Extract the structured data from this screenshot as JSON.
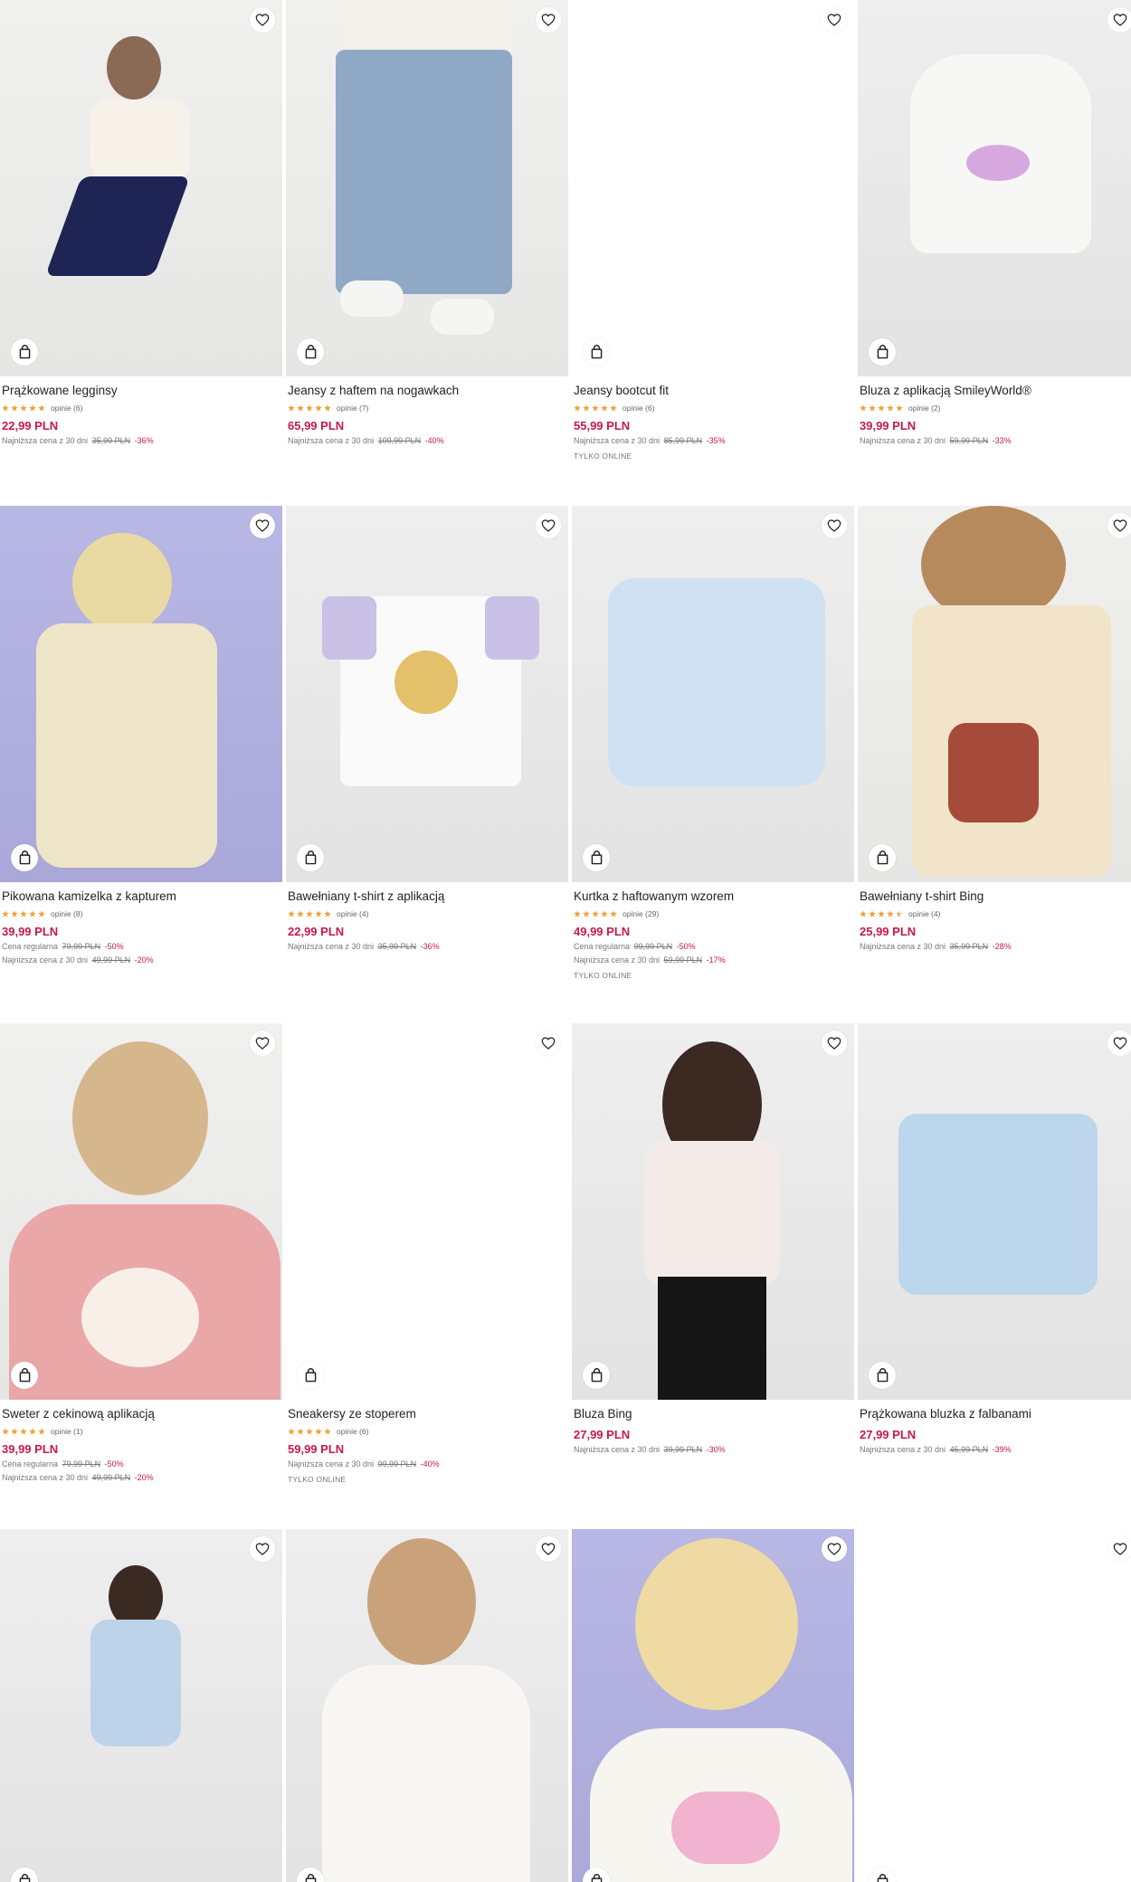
{
  "products": [
    {
      "name": "Prążkowane legginsy",
      "rating": 5,
      "reviews": "opinie (6)",
      "price": "22,99 PLN",
      "notes": [
        {
          "label": "Najniższa cena z 30 dni",
          "old": "35,99 PLN",
          "discount": "-36%"
        }
      ],
      "online": ""
    },
    {
      "name": "Jeansy z haftem na nogawkach",
      "rating": 5,
      "reviews": "opinie (7)",
      "price": "65,99 PLN",
      "notes": [
        {
          "label": "Najniższa cena z 30 dni",
          "old": "109,99 PLN",
          "discount": "-40%"
        }
      ],
      "online": ""
    },
    {
      "name": "Jeansy bootcut fit",
      "rating": 5,
      "reviews": "opinie (6)",
      "price": "55,99 PLN",
      "notes": [
        {
          "label": "Najniższa cena z 30 dni",
          "old": "85,99 PLN",
          "discount": "-35%"
        }
      ],
      "online": "TYLKO ONLINE"
    },
    {
      "name": "Bluza z aplikacją SmileyWorld®",
      "rating": 5,
      "reviews": "opinie (2)",
      "price": "39,99 PLN",
      "notes": [
        {
          "label": "Najniższa cena z 30 dni",
          "old": "59,99 PLN",
          "discount": "-33%"
        }
      ],
      "online": ""
    },
    {
      "name": "Pikowana kamizelka z kapturem",
      "rating": 5,
      "reviews": "opinie (8)",
      "price": "39,99 PLN",
      "notes": [
        {
          "label": "Cena regularna",
          "old": "79,99 PLN",
          "discount": "-50%"
        },
        {
          "label": "Najniższa cena z 30 dni",
          "old": "49,99 PLN",
          "discount": "-20%"
        }
      ],
      "online": ""
    },
    {
      "name": "Bawełniany t-shirt z aplikacją",
      "rating": 5,
      "reviews": "opinie (4)",
      "price": "22,99 PLN",
      "notes": [
        {
          "label": "Najniższa cena z 30 dni",
          "old": "35,99 PLN",
          "discount": "-36%"
        }
      ],
      "online": ""
    },
    {
      "name": "Kurtka z haftowanym wzorem",
      "rating": 5,
      "reviews": "opinie (29)",
      "price": "49,99 PLN",
      "notes": [
        {
          "label": "Cena regularna",
          "old": "99,99 PLN",
          "discount": "-50%"
        },
        {
          "label": "Najniższa cena z 30 dni",
          "old": "59,99 PLN",
          "discount": "-17%"
        }
      ],
      "online": "TYLKO ONLINE"
    },
    {
      "name": "Bawełniany t-shirt Bing",
      "rating": 4.5,
      "reviews": "opinie (4)",
      "price": "25,99 PLN",
      "notes": [
        {
          "label": "Najniższa cena z 30 dni",
          "old": "35,99 PLN",
          "discount": "-28%"
        }
      ],
      "online": ""
    },
    {
      "name": "Sweter z cekinową aplikacją",
      "rating": 5,
      "reviews": "opinie (1)",
      "price": "39,99 PLN",
      "notes": [
        {
          "label": "Cena regularna",
          "old": "79,99 PLN",
          "discount": "-50%"
        },
        {
          "label": "Najniższa cena z 30 dni",
          "old": "49,99 PLN",
          "discount": "-20%"
        }
      ],
      "online": ""
    },
    {
      "name": "Sneakersy ze stoperem",
      "rating": 5,
      "reviews": "opinie (6)",
      "price": "59,99 PLN",
      "notes": [
        {
          "label": "Najniższa cena z 30 dni",
          "old": "99,99 PLN",
          "discount": "-40%"
        }
      ],
      "online": "TYLKO ONLINE"
    },
    {
      "name": "Bluza Bing",
      "rating": 0,
      "reviews": "",
      "price": "27,99 PLN",
      "notes": [
        {
          "label": "Najniższa cena z 30 dni",
          "old": "39,99 PLN",
          "discount": "-30%"
        }
      ],
      "online": ""
    },
    {
      "name": "Prążkowana bluzka z falbanami",
      "rating": 0,
      "reviews": "",
      "price": "27,99 PLN",
      "notes": [
        {
          "label": "Najniższa cena z 30 dni",
          "old": "45,99 PLN",
          "discount": "-39%"
        }
      ],
      "online": ""
    },
    {
      "name": "",
      "rating": 0,
      "reviews": "",
      "price": "",
      "notes": [],
      "online": ""
    },
    {
      "name": "",
      "rating": 0,
      "reviews": "",
      "price": "",
      "notes": [],
      "online": ""
    },
    {
      "name": "",
      "rating": 0,
      "reviews": "",
      "price": "",
      "notes": [],
      "online": ""
    },
    {
      "name": "",
      "rating": 0,
      "reviews": "",
      "price": "",
      "notes": [],
      "online": ""
    }
  ],
  "icons": {
    "favorite": "heart-outline-icon",
    "cart": "shopping-bag-icon",
    "star": "star-icon"
  },
  "colors": {
    "price": "#c8194b",
    "star": "#f0a23b",
    "star_empty": "#d9d9d9"
  }
}
